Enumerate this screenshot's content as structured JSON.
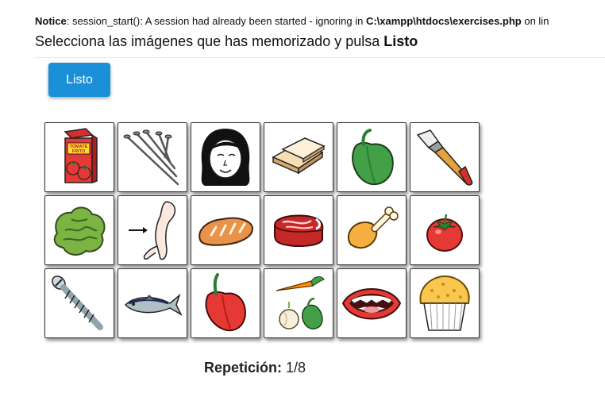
{
  "notice": {
    "prefix": "Notice",
    "message": ": session_start(): A session had already been started - ignoring in ",
    "file": "C:\\xampp\\htdocs\\exercises.php",
    "suffix": " on lin"
  },
  "instruction": {
    "text": "Selecciona las imágenes que has memorizado y pulsa ",
    "emphasis": "Listo"
  },
  "listo_button": {
    "label": "Listo",
    "color": "#1a90d9"
  },
  "images": [
    "tomato-sauce-carton",
    "nails",
    "girl-face",
    "bread-slices",
    "green-pepper",
    "paintbrush",
    "lettuce",
    "arm",
    "bread-loaf",
    "meat",
    "chicken-leg",
    "tomato",
    "screw",
    "fish",
    "red-pepper",
    "vegetables",
    "mouth",
    "muffin"
  ],
  "carton_text": [
    "TOMATE",
    "FRITO"
  ],
  "repeticion": {
    "label": "Repetición:",
    "value": "1/8"
  }
}
